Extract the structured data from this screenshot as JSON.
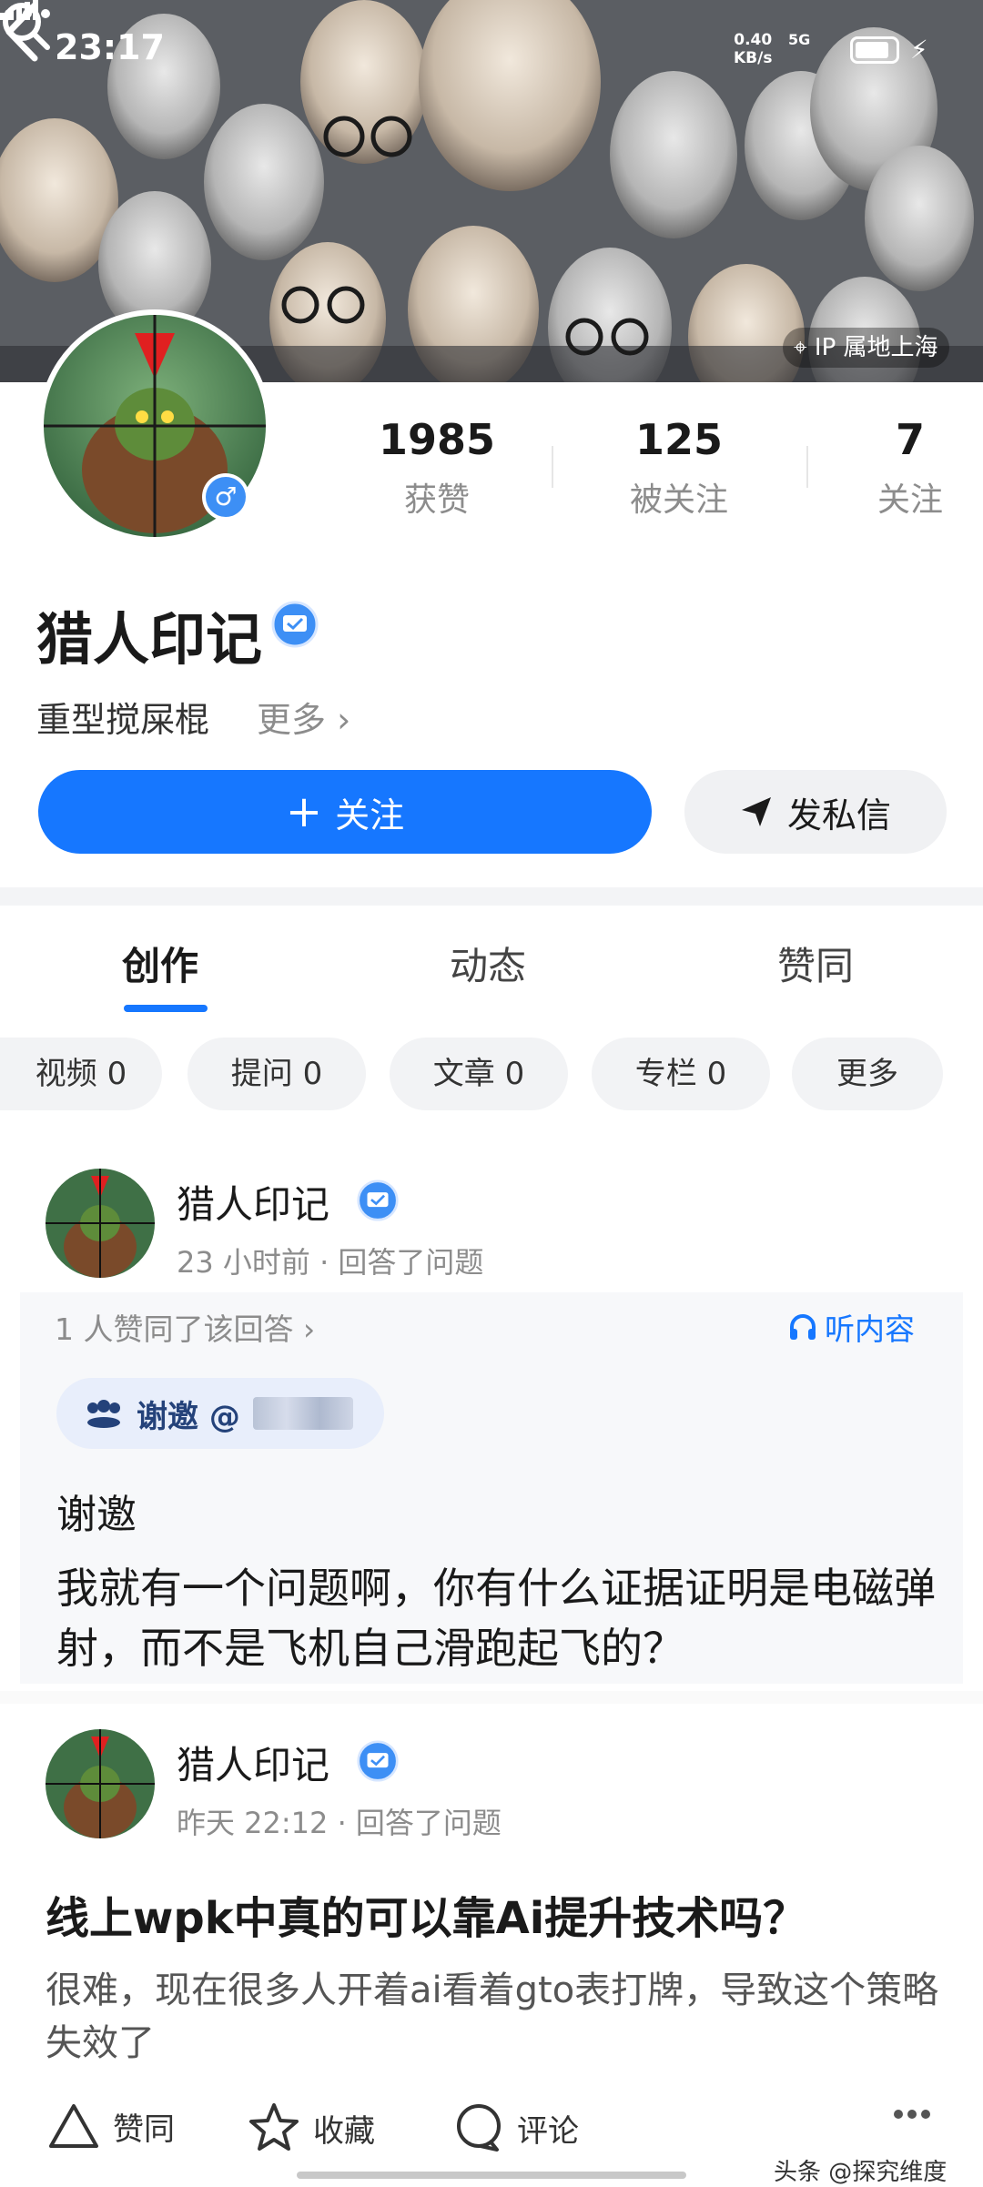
{
  "status_bar": {
    "time": "23:17",
    "net_speed": "0.40",
    "net_unit": "KB/s",
    "network": "5G"
  },
  "header": {
    "ip_location": "IP 属地上海"
  },
  "profile": {
    "name": "猎人印记",
    "bio": "重型搅屎棍",
    "bio_more": "更多",
    "stats": [
      {
        "value": "1985",
        "label": "获赞"
      },
      {
        "value": "125",
        "label": "被关注"
      },
      {
        "value": "7",
        "label": "关注"
      }
    ],
    "follow_label": "关注",
    "dm_label": "发私信",
    "gender": "♂"
  },
  "tabs": [
    {
      "label": "创作",
      "active": true
    },
    {
      "label": "动态",
      "active": false
    },
    {
      "label": "赞同",
      "active": false
    }
  ],
  "filters": [
    "视频 0",
    "提问 0",
    "文章 0",
    "专栏 0",
    "更多"
  ],
  "posts": [
    {
      "author": "猎人印记",
      "time": "23 小时前",
      "action": "回答了问题",
      "liked_by": "1 人赞同了该回答",
      "listen_label": "听内容",
      "invite_label": "谢邀 @",
      "thanks": "谢邀",
      "body": "我就有一个问题啊，你有什么证据证明是电磁弹射，而不是飞机自己滑跑起飞的？"
    },
    {
      "author": "猎人印记",
      "time": "昨天 22:12",
      "action": "回答了问题",
      "question": "线上wpk中真的可以靠Ai提升技术吗？",
      "body": "很难，现在很多人开着ai看着gto表打牌，导致这个策略失效了"
    }
  ],
  "actions": {
    "like": "赞同",
    "collect": "收藏",
    "comment": "评论"
  },
  "watermark": "头条 @探究维度",
  "colors": {
    "accent": "#1677ff",
    "badge": "#3d8ff5"
  }
}
